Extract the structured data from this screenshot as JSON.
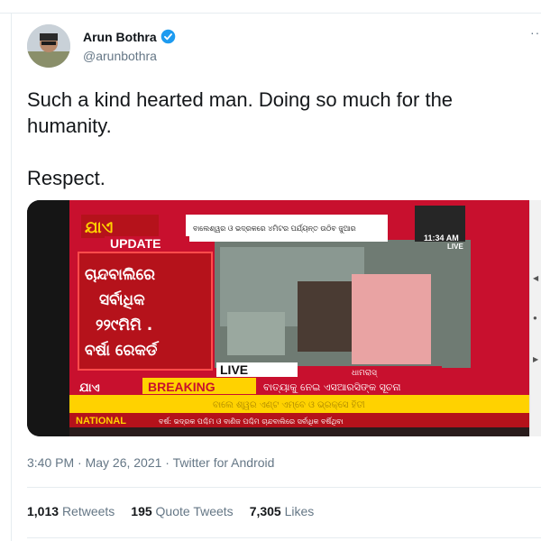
{
  "tweet": {
    "author": {
      "display_name": "Arun Bothra",
      "handle": "@arunbothra",
      "verified": true
    },
    "more_icon": "more-horizontal-icon",
    "text": "Such a kind hearted man. Doing so much for the humanity.\n\nRespect.",
    "timestamp": "3:40 PM · May 26, 2021 · Twitter for Android",
    "stats": {
      "retweets": {
        "count": "1,013",
        "label": "Retweets"
      },
      "quote_tweets": {
        "count": "195",
        "label": "Quote Tweets"
      },
      "likes": {
        "count": "7,305",
        "label": "Likes"
      }
    }
  },
  "media": {
    "channel_logo": "ଯାଏ",
    "update_label": "UPDATE",
    "headline_box_lines": [
      "ଚାନ୍ଦବାଲିରେ",
      "ସର୍ବାଧିକ",
      "୨୨୯ମିମି .",
      "ବର୍ଷା ରେକର୍ଡ"
    ],
    "top_caption": "ବାଲେଶ୍ୱର ଓ ଭଦ୍ରକରେ ୪ମିଟର ପର୍ଯ୍ୟନ୍ତ ଉଠିବ ଜୁଆର",
    "time": "11:34 AM",
    "live_tag": "LIVE",
    "live_label": "LIVE",
    "location": "ଧାମରାସ୍",
    "breaking_logo": "ଯାଏ",
    "breaking_label": "BREAKING",
    "breaking_text": "ବାତ୍ୟାକୁ ନେଇ ଏସଆରସିଙ୍କ ସୂଚନା",
    "ticker_text": "ବାଲେ ଶ୍ୱର ଏଣ୍ଟ ଏମ୍ବେ ଓ ଭ୍ରକ୍ସେ ହିତୀ",
    "national_label": "NATIONAL",
    "national_text": "ବର୍ଷ: ଭଦ୍ରକ ପଶ୍ଚିମ ଓ ବାଣିଜ ପଶ୍ଚିମ ଚାନ୍ଦବାଲିରେ ସର୍ବାଧିକ ବର୍ଷିଥିବା"
  }
}
